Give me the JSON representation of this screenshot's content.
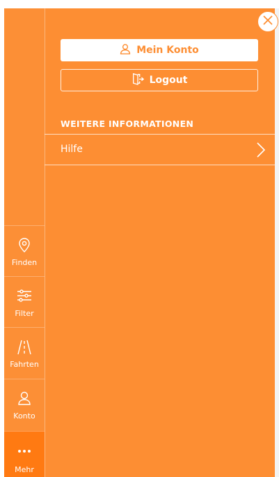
{
  "colors": {
    "accent": "#fd8e33",
    "accent_dark": "#ff7a12",
    "text_on_accent": "#ffffff"
  },
  "sidebar": {
    "items": [
      {
        "label": "Finden",
        "icon": "location-pin-icon"
      },
      {
        "label": "Filter",
        "icon": "sliders-icon"
      },
      {
        "label": "Fahrten",
        "icon": "road-icon"
      },
      {
        "label": "Konto",
        "icon": "user-icon"
      },
      {
        "label": "Mehr",
        "icon": "more-dots-icon",
        "active": true
      }
    ]
  },
  "menu": {
    "account_button": {
      "label": "Mein Konto",
      "icon": "user-icon"
    },
    "logout_button": {
      "label": "Logout",
      "icon": "logout-door-icon"
    },
    "section_title": "WEITERE INFORMATIONEN",
    "items": [
      {
        "label": "Hilfe",
        "icon": "chevron-right-icon"
      }
    ]
  },
  "close_button": {
    "icon": "close-icon"
  }
}
